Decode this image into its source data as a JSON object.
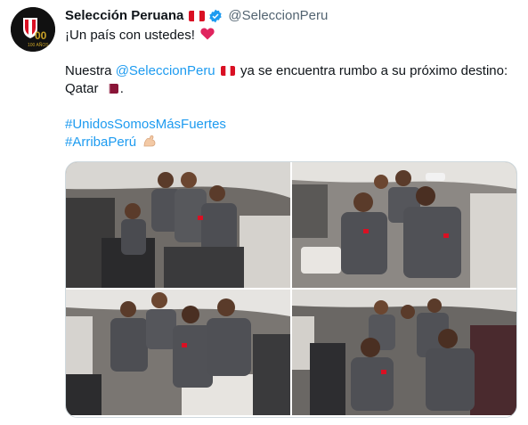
{
  "tweet": {
    "author_name": "Selección Peruana",
    "handle": "@SeleccionPeru",
    "line1": "¡Un país con ustedes!",
    "line2_prefix": "Nuestra ",
    "line2_mention": "@SeleccionPeru",
    "line2_suffix": " ya se encuentra rumbo a su próximo destino:",
    "line3": "Qatar",
    "line3_end": ".",
    "hashtag1": "#UnidosSomosMásFuertes",
    "hashtag2": "#ArribaPerú"
  },
  "avatar": {
    "text": "100 AÑOS"
  },
  "icons": {
    "verified": "verified-badge-icon",
    "flag_peru": "peru-flag-icon",
    "flag_qatar": "qatar-flag-icon",
    "heart": "red-heart-icon",
    "flexed_bicep": "flexed-bicep-icon"
  },
  "colors": {
    "link": "#1d9bf0",
    "handle": "#536471",
    "verified": "#1d9bf0",
    "heart": "#e0245e"
  },
  "photos": [
    {
      "name": "photo-1"
    },
    {
      "name": "photo-2"
    },
    {
      "name": "photo-3"
    },
    {
      "name": "photo-4"
    }
  ]
}
